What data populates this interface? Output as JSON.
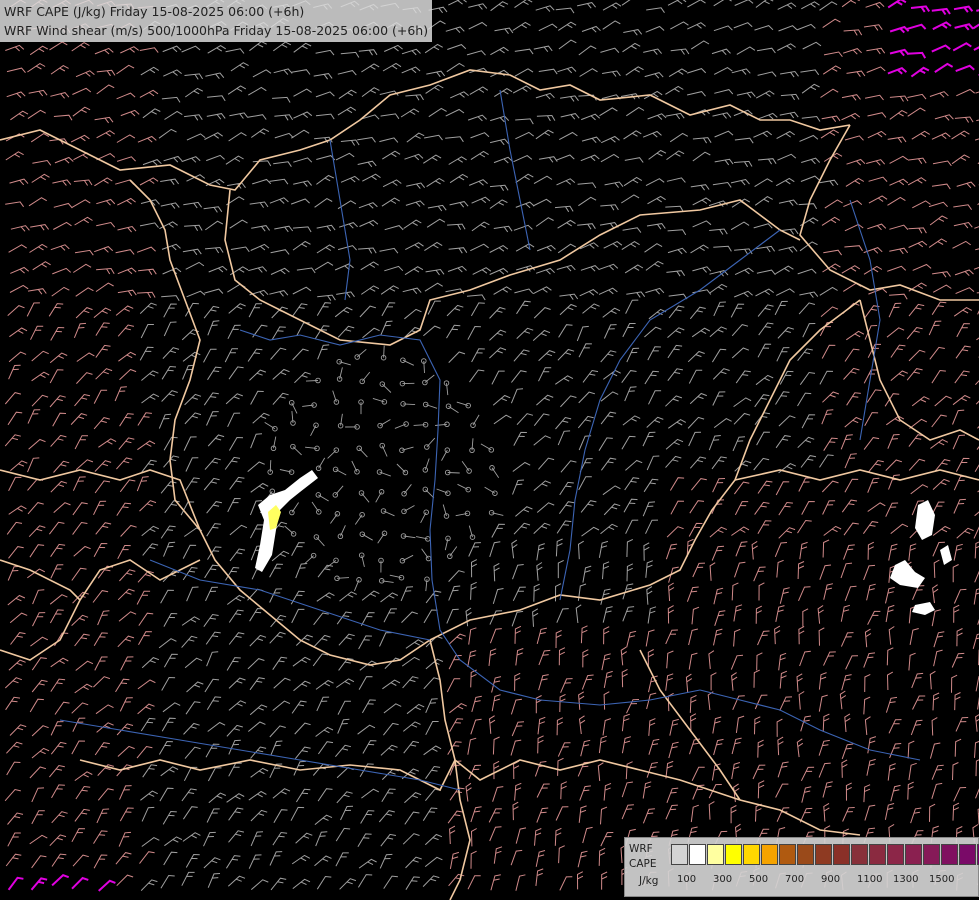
{
  "title": {
    "line1": "WRF CAPE (J/kg) Friday 15-08-2025 06:00 (+6h)",
    "line2": "WRF Wind shear (m/s) 500/1000hPa Friday 15-08-2025 06:00 (+6h)"
  },
  "legend": {
    "label_line1": "WRF",
    "label_line2": "CAPE",
    "label_line3": "J/kg",
    "colors": [
      "#d4d4d4",
      "#ffffff",
      "#ffffa0",
      "#ffff00",
      "#ffd700",
      "#f5a300",
      "#b05a10",
      "#9a4a1a",
      "#8e3a22",
      "#8a3028",
      "#88303a",
      "#8a2a40",
      "#8c2648",
      "#8a2050",
      "#861a58",
      "#801060",
      "#7a0a68",
      "#76006e"
    ],
    "tick_labels": [
      "100",
      "300",
      "500",
      "700",
      "900",
      "1100",
      "1300",
      "1500"
    ]
  },
  "map_colors": {
    "background": "#000000",
    "borders": "#f0c8a0",
    "rivers": "#3c64b4",
    "barb_gray": "#a0a0a0",
    "barb_pink": "#d08a8a",
    "barb_magenta": "#e000e0",
    "cape_low": "#ffffff",
    "cape_yellow": "#ffff60"
  }
}
